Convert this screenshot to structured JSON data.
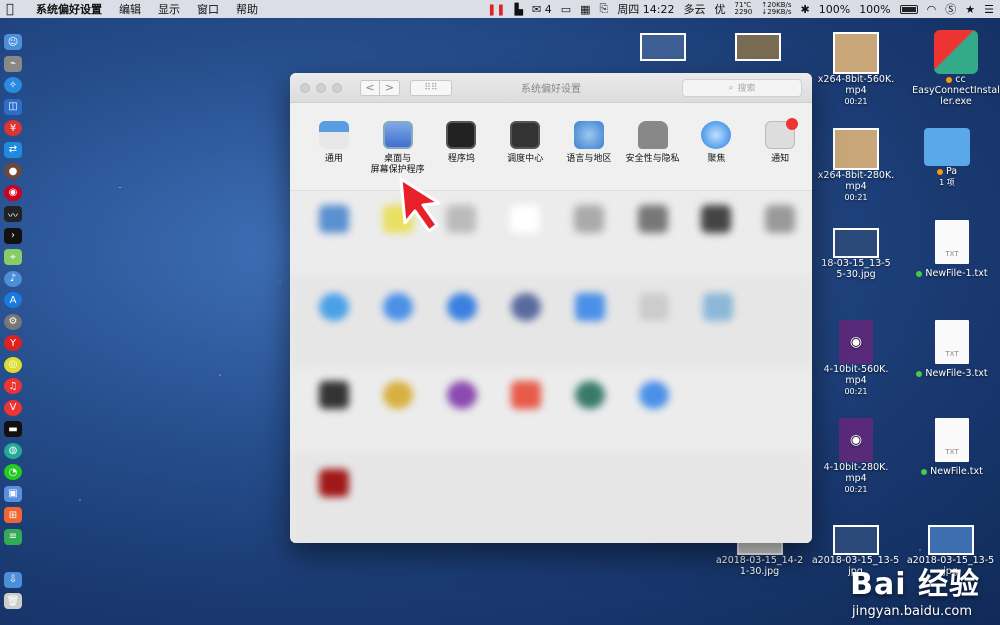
{
  "menubar": {
    "app_name": "系统偏好设置",
    "items": [
      "编辑",
      "显示",
      "窗口",
      "帮助"
    ],
    "wechat_count": "4",
    "clock": "周四 14:22",
    "weather": "多云",
    "weather2": "优",
    "cpu_temp": "71℃",
    "cpu_rpm": "2290",
    "net_up": "↑20KB/s",
    "net_down": "↓29KB/s",
    "volume_pct": "100%",
    "battery_pct": "100%"
  },
  "window": {
    "title": "系统偏好设置",
    "search_placeholder": "搜索",
    "nav_back": "<",
    "nav_forward": ">",
    "top_row": [
      {
        "label": "通用",
        "label2": "",
        "icon": "general-icon"
      },
      {
        "label": "桌面与",
        "label2": "屏幕保护程序",
        "icon": "desktop-screensaver-icon"
      },
      {
        "label": "程序坞",
        "label2": "",
        "icon": "dock-icon"
      },
      {
        "label": "调度中心",
        "label2": "",
        "icon": "mission-control-icon"
      },
      {
        "label": "语言与地区",
        "label2": "",
        "icon": "language-region-icon"
      },
      {
        "label": "安全性与隐私",
        "label2": "",
        "icon": "security-privacy-icon"
      },
      {
        "label": "聚焦",
        "label2": "",
        "icon": "spotlight-icon"
      },
      {
        "label": "通知",
        "label2": "",
        "icon": "notifications-icon"
      }
    ]
  },
  "desktop": {
    "icons": [
      {
        "name": "x264-8bit-560K.",
        "name2": "mp4",
        "sub": "00:21"
      },
      {
        "name": "x264-8bit-280K.",
        "name2": "mp4",
        "sub": "00:21"
      },
      {
        "name": "cc",
        "name2": "EasyConnectInstal",
        "name3": "ler.exe"
      },
      {
        "name": "Pa",
        "sub": "1 项"
      },
      {
        "name": "18-03-15_13-5",
        "name2": "5-30.jpg"
      },
      {
        "name": "NewFile-1.txt"
      },
      {
        "name": "4-10bit-560K.",
        "name2": "mp4",
        "sub": "00:21"
      },
      {
        "name": "NewFile-3.txt"
      },
      {
        "name": "4-10bit-280K.",
        "name2": "mp4",
        "sub": "00:21"
      },
      {
        "name": "NewFile.txt"
      },
      {
        "name": "a2018-03-15_14-2",
        "name2": "1-30.jpg"
      },
      {
        "name": "a2018-03-15_13-5",
        "name2": "jpg"
      },
      {
        "name": "a2018-03-15_13-5",
        "name2": "jpg"
      }
    ],
    "txt_label": "TXT"
  },
  "watermark": {
    "brand": "Bai 经验",
    "url": "jingyan.baidu.com"
  }
}
